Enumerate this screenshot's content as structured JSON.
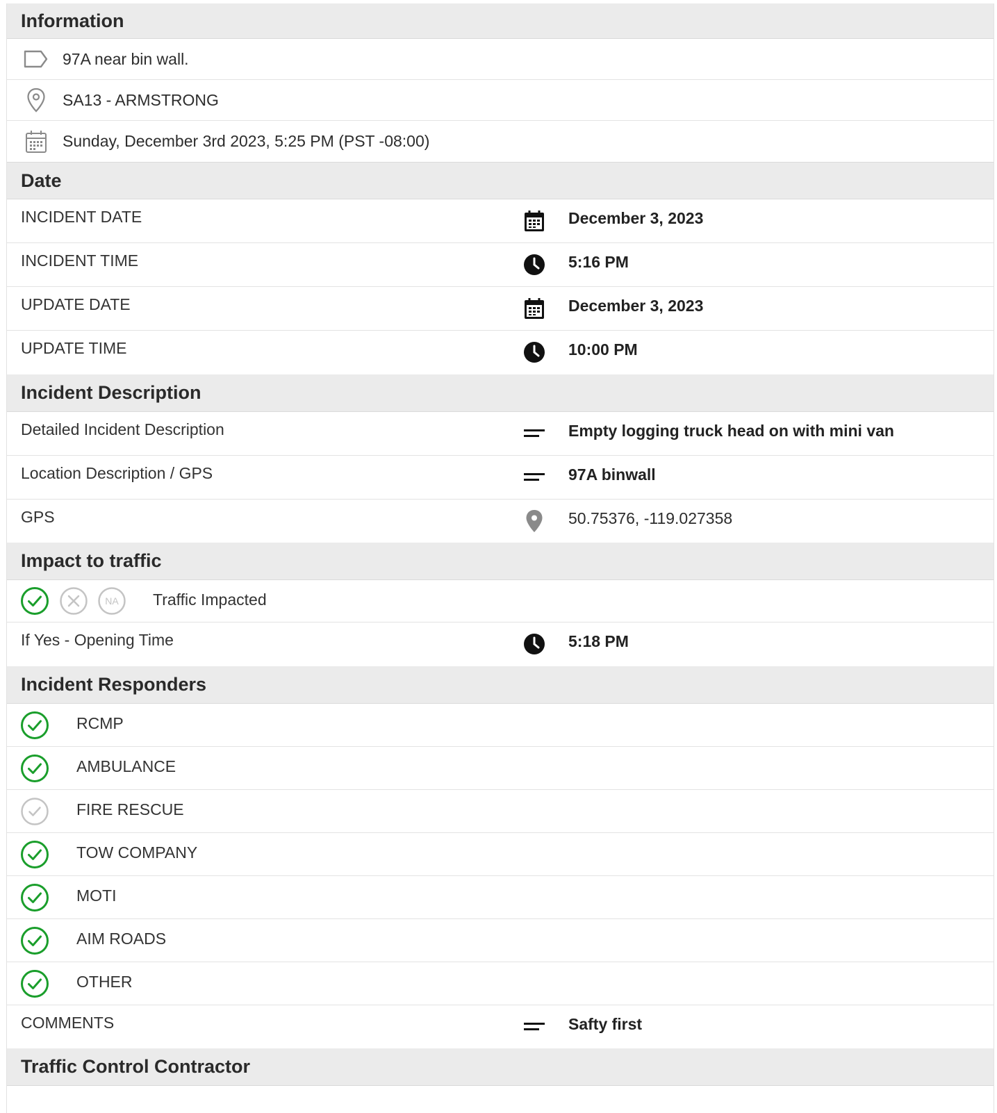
{
  "colors": {
    "section_bg": "#ebebeb",
    "check_green": "#1a9e2b",
    "check_grey": "#c4c4c4",
    "icon_dark": "#111111",
    "icon_grey": "#8a8a8a"
  },
  "information": {
    "title": "Information",
    "summary": {
      "icon": "tag-icon",
      "text": "97A near bin wall."
    },
    "location": {
      "icon": "map-pin-outline-icon",
      "text": "SA13 - ARMSTRONG"
    },
    "datetime": {
      "icon": "calendar-outline-icon",
      "text": "Sunday, December 3rd 2023, 5:25 PM (PST -08:00)"
    }
  },
  "date": {
    "title": "Date",
    "rows": [
      {
        "label": "INCIDENT DATE",
        "icon": "calendar-icon",
        "value": "December 3, 2023"
      },
      {
        "label": "INCIDENT TIME",
        "icon": "clock-icon",
        "value": "5:16 PM"
      },
      {
        "label": "UPDATE DATE",
        "icon": "calendar-icon",
        "value": "December 3, 2023"
      },
      {
        "label": "UPDATE TIME",
        "icon": "clock-icon",
        "value": "10:00 PM"
      }
    ]
  },
  "description": {
    "title": "Incident Description",
    "rows": [
      {
        "label": "Detailed Incident Description",
        "icon": "text-lines-icon",
        "value": "Empty logging truck head on with mini van"
      },
      {
        "label": "Location Description / GPS",
        "icon": "text-lines-icon",
        "value": "97A binwall"
      },
      {
        "label": "GPS",
        "icon": "map-pin-icon",
        "value": "50.75376, -119.027358"
      }
    ]
  },
  "traffic": {
    "title": "Impact to traffic",
    "status": {
      "selected": "yes",
      "yes_icon": "check-circle-icon",
      "no_icon": "x-circle-icon",
      "na_label": "NA",
      "label": "Traffic Impacted"
    },
    "opening": {
      "label": "If Yes - Opening Time",
      "icon": "clock-icon",
      "value": "5:18 PM"
    }
  },
  "responders": {
    "title": "Incident Responders",
    "items": [
      {
        "label": "RCMP",
        "checked": true
      },
      {
        "label": "AMBULANCE",
        "checked": true
      },
      {
        "label": "FIRE RESCUE",
        "checked": false
      },
      {
        "label": "TOW COMPANY",
        "checked": true
      },
      {
        "label": "MOTI",
        "checked": true
      },
      {
        "label": "AIM ROADS",
        "checked": true
      },
      {
        "label": "OTHER",
        "checked": true
      }
    ],
    "comments": {
      "label": "COMMENTS",
      "icon": "text-lines-icon",
      "value": "Safty first"
    }
  },
  "contractor": {
    "title": "Traffic Control Contractor"
  }
}
